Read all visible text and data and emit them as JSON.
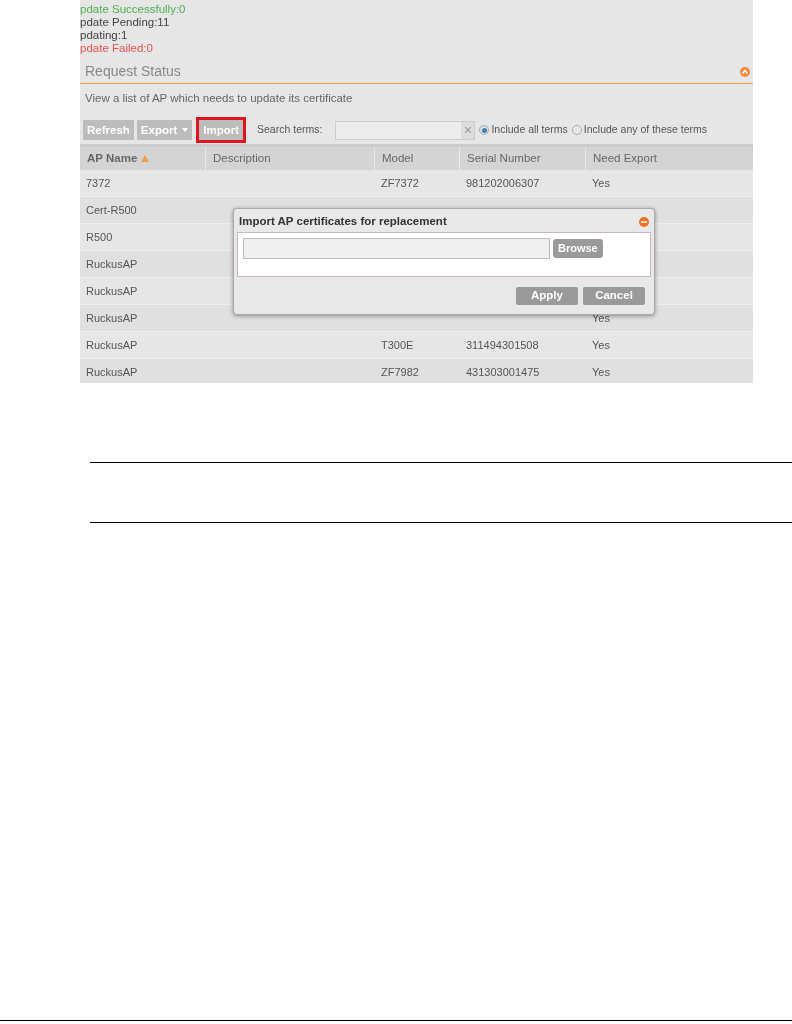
{
  "status_counts": [
    {
      "text": "pdate Successfully:0",
      "kind": "success"
    },
    {
      "text": "pdate Pending:11",
      "kind": "neutral"
    },
    {
      "text": "pdating:1",
      "kind": "neutral"
    },
    {
      "text": "pdate Failed:0",
      "kind": "failed"
    }
  ],
  "panel": {
    "title": "Request Status",
    "expanded": true,
    "description": "View a list of AP which needs to update its certificate"
  },
  "toolbar": {
    "buttons": [
      {
        "label": "Refresh",
        "kind": "plain"
      },
      {
        "label": "Export",
        "kind": "dropdown"
      },
      {
        "label": "Import",
        "kind": "highlighted"
      }
    ],
    "search": {
      "label": "Search terms:"
    },
    "options": [
      {
        "label": "Include all terms",
        "selected": true
      },
      {
        "label": "Include any of these terms",
        "selected": false
      }
    ]
  },
  "table": {
    "columns": [
      {
        "label": "AP Name",
        "sorted": true
      },
      {
        "label": "Description",
        "sorted": false
      },
      {
        "label": "Model",
        "sorted": false
      },
      {
        "label": "Serial Number",
        "sorted": false
      },
      {
        "label": "Need Export",
        "sorted": false
      }
    ],
    "rows": [
      [
        "7372",
        "",
        "ZF7372",
        "981202006307",
        "Yes"
      ],
      [
        "Cert-R500",
        "",
        "",
        "",
        ""
      ],
      [
        "R500",
        "",
        "",
        "",
        ""
      ],
      [
        "RuckusAP",
        "",
        "",
        "",
        ""
      ],
      [
        "RuckusAP",
        "",
        "",
        "",
        ""
      ],
      [
        "RuckusAP",
        "",
        "",
        "",
        "Yes"
      ],
      [
        "RuckusAP",
        "",
        "T300E",
        "311494301508",
        "Yes"
      ],
      [
        "RuckusAP",
        "",
        "ZF7982",
        "431303001475",
        "Yes"
      ]
    ]
  },
  "dialog": {
    "title": "Import AP certificates for replacement",
    "browse": "Browse",
    "buttons": [
      "Apply",
      "Cancel"
    ]
  }
}
